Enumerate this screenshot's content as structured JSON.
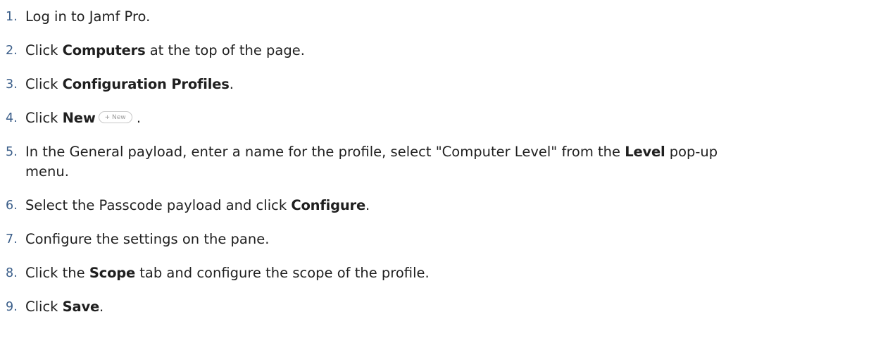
{
  "steps": [
    {
      "num": "1.",
      "pre": "Log in to Jamf Pro.",
      "bold": "",
      "post": ""
    },
    {
      "num": "2.",
      "pre": "Click ",
      "bold": "Computers",
      "post": " at the top of the page."
    },
    {
      "num": "3.",
      "pre": "Click ",
      "bold": "Configuration Profiles",
      "post": "."
    },
    {
      "num": "4.",
      "pre": "Click ",
      "bold": "New",
      "post": " .",
      "button_label": "+ New"
    },
    {
      "num": "5.",
      "pre": "In the General payload, enter a name for the profile, select \"Computer Level\" from the ",
      "bold": "Level",
      "post": " pop-up",
      "continuation": "menu."
    },
    {
      "num": "6.",
      "pre": "Select the Passcode payload and click ",
      "bold": "Configure",
      "post": "."
    },
    {
      "num": "7.",
      "pre": "Configure the settings on the pane.",
      "bold": "",
      "post": ""
    },
    {
      "num": "8.",
      "pre": "Click the ",
      "bold": "Scope",
      "post": " tab and configure the scope of the profile."
    },
    {
      "num": "9.",
      "pre": "Click ",
      "bold": "Save",
      "post": "."
    }
  ]
}
